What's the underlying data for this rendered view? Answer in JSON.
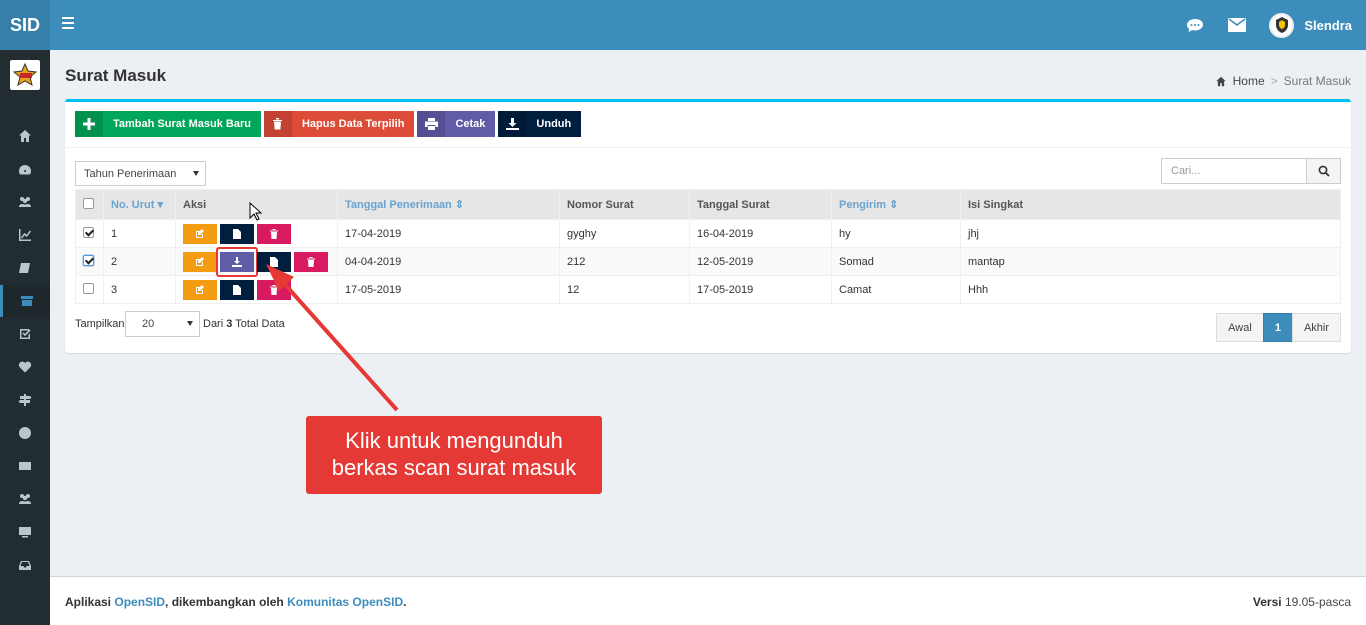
{
  "header": {
    "logo": "SID",
    "user_name": "Slendra"
  },
  "content": {
    "title": "Surat Masuk",
    "breadcrumb": {
      "home": "Home",
      "current": "Surat Masuk"
    }
  },
  "toolbar": {
    "add_label": "Tambah Surat Masuk Baru",
    "delete_label": "Hapus Data Terpilih",
    "print_label": "Cetak",
    "download_label": "Unduh"
  },
  "filter": {
    "year_select": "Tahun Penerimaan",
    "search_placeholder": "Cari..."
  },
  "table": {
    "columns": [
      "No. Urut",
      "Aksi",
      "Tanggal Penerimaan",
      "Nomor Surat",
      "Tanggal Surat",
      "Pengirim",
      "Isi Singkat"
    ],
    "rows": [
      {
        "no": "1",
        "tanggal_penerimaan": "17-04-2019",
        "nomor_surat": "gyghy",
        "tanggal_surat": "16-04-2019",
        "pengirim": "hy",
        "isi": "jhj"
      },
      {
        "no": "2",
        "tanggal_penerimaan": "04-04-2019",
        "nomor_surat": "212",
        "tanggal_surat": "12-05-2019",
        "pengirim": "Somad",
        "isi": "mantap"
      },
      {
        "no": "3",
        "tanggal_penerimaan": "17-05-2019",
        "nomor_surat": "12",
        "tanggal_surat": "17-05-2019",
        "pengirim": "Camat",
        "isi": "Hhh"
      }
    ]
  },
  "paging": {
    "show_label": "Tampilkan",
    "per_page": "20",
    "total_prefix": "Dari",
    "total_count": "3",
    "total_suffix": "Total Data",
    "first": "Awal",
    "current": "1",
    "last": "Akhir"
  },
  "annotation": {
    "line1": "Klik untuk mengunduh",
    "line2": "berkas scan surat masuk"
  },
  "footer": {
    "prefix": "Aplikasi",
    "app": "OpenSID",
    "middle": ", dikembangkan oleh",
    "community": "Komunitas OpenSID",
    "end": ".",
    "version_label": "Versi",
    "version": "19.05-pasca"
  },
  "colors": {
    "header": "#3c8dbc",
    "sidebar": "#222d32",
    "accent_top": "#00c0ef",
    "annotation": "#e53935"
  }
}
